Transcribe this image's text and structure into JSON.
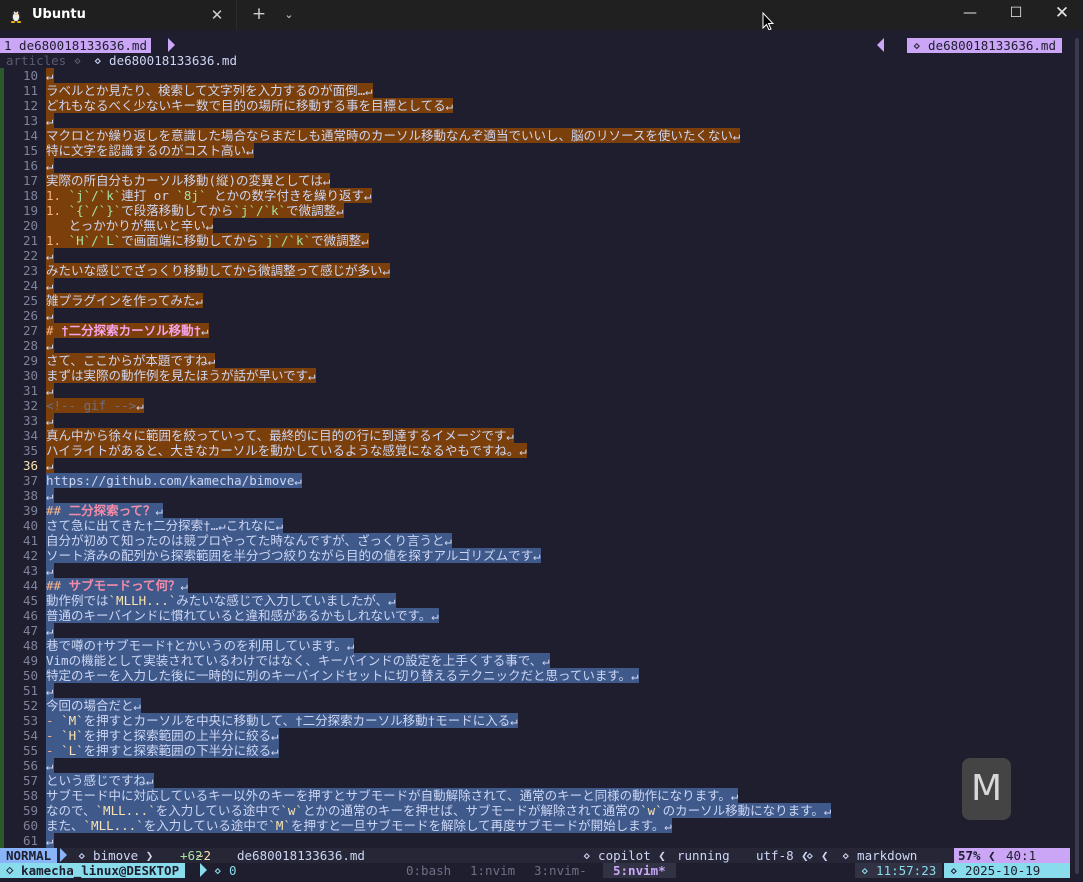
{
  "window": {
    "tab_title": "Ubuntu",
    "tab_close": "✕",
    "new_tab": "+",
    "dropdown": "⌄",
    "minimize": "—",
    "maximize": "☐",
    "close": "✕"
  },
  "tabline": {
    "buffer": "1 de680018133636.md",
    "right": "⋄ de680018133636.md"
  },
  "winbar": {
    "dir": "articles ⋄",
    "file": "⋄ de680018133636.md"
  },
  "editor": {
    "lines": [
      {
        "n": "10",
        "segs": [
          {
            "t": "↵",
            "c": "sel-brown"
          }
        ]
      },
      {
        "n": "11",
        "segs": [
          {
            "t": "ラベルとか見たり、検索して文字列を入力するのが面倒…↵",
            "c": "sel-brown"
          }
        ]
      },
      {
        "n": "12",
        "segs": [
          {
            "t": "どれもなるべく少ないキー数で目的の場所に移動する事を目標としてる↵",
            "c": "sel-brown"
          }
        ]
      },
      {
        "n": "13",
        "segs": [
          {
            "t": "↵",
            "c": "sel-brown"
          }
        ]
      },
      {
        "n": "14",
        "segs": [
          {
            "t": "マクロとか繰り返しを意識した場合ならまだしも通常時のカーソル移動なんぞ適当でいいし、脳のリソースを使いたくない↵",
            "c": "sel-brown"
          }
        ]
      },
      {
        "n": "15",
        "segs": [
          {
            "t": "特に文字を認識するのがコスト高い↵",
            "c": "sel-brown"
          }
        ]
      },
      {
        "n": "16",
        "segs": [
          {
            "t": "↵",
            "c": "sel-brown"
          }
        ]
      },
      {
        "n": "17",
        "segs": [
          {
            "t": "実際の所自分もカーソル移動(縦)の変異としては↵",
            "c": "sel-brown"
          }
        ]
      },
      {
        "n": "18",
        "segs": [
          {
            "t": "1. ",
            "c": "sel-brown c-orange"
          },
          {
            "t": "`j`/`k`",
            "c": "sel-brown c-green"
          },
          {
            "t": "連打 or ",
            "c": "sel-brown"
          },
          {
            "t": "`8j`",
            "c": "sel-brown c-green"
          },
          {
            "t": " とかの数字付きを繰り返す↵",
            "c": "sel-brown"
          }
        ]
      },
      {
        "n": "19",
        "segs": [
          {
            "t": "1. ",
            "c": "sel-brown c-orange"
          },
          {
            "t": "`{`/`}`",
            "c": "sel-brown c-green"
          },
          {
            "t": "で段落移動してから",
            "c": "sel-brown"
          },
          {
            "t": "`j`/`k`",
            "c": "sel-brown c-green"
          },
          {
            "t": "で微調整↵",
            "c": "sel-brown"
          }
        ]
      },
      {
        "n": "20",
        "segs": [
          {
            "t": "   とっかかりが無いと辛い↵",
            "c": "sel-brown"
          }
        ]
      },
      {
        "n": "21",
        "segs": [
          {
            "t": "1. ",
            "c": "sel-brown c-orange"
          },
          {
            "t": "`H`/`L`",
            "c": "sel-brown c-green"
          },
          {
            "t": "で画面端に移動してから",
            "c": "sel-brown"
          },
          {
            "t": "`j`/`k`",
            "c": "sel-brown c-green"
          },
          {
            "t": "で微調整↵",
            "c": "sel-brown"
          }
        ]
      },
      {
        "n": "22",
        "segs": [
          {
            "t": "↵",
            "c": "sel-brown"
          }
        ]
      },
      {
        "n": "23",
        "segs": [
          {
            "t": "みたいな感じでざっくり移動してから微調整って感じが多い↵",
            "c": "sel-brown"
          }
        ]
      },
      {
        "n": "24",
        "segs": [
          {
            "t": "↵",
            "c": "sel-brown"
          }
        ]
      },
      {
        "n": "25",
        "segs": [
          {
            "t": "雑プラグインを作ってみた↵",
            "c": "sel-brown"
          }
        ]
      },
      {
        "n": "26",
        "segs": [
          {
            "t": "↵",
            "c": "sel-brown"
          }
        ]
      },
      {
        "n": "27",
        "segs": [
          {
            "t": "# ",
            "c": "sel-brown c-orange"
          },
          {
            "t": "†二分探索カーソル移動†",
            "c": "sel-brown h-purple"
          },
          {
            "t": "↵",
            "c": "sel-brown"
          }
        ]
      },
      {
        "n": "28",
        "segs": [
          {
            "t": "↵",
            "c": "sel-brown"
          }
        ]
      },
      {
        "n": "29",
        "segs": [
          {
            "t": "さて、ここからが本題ですね↵",
            "c": "sel-brown"
          }
        ]
      },
      {
        "n": "30",
        "segs": [
          {
            "t": "まずは実際の動作例を見たほうが話が早いです↵",
            "c": "sel-brown"
          }
        ]
      },
      {
        "n": "31",
        "segs": [
          {
            "t": "↵",
            "c": "sel-brown"
          }
        ]
      },
      {
        "n": "32",
        "segs": [
          {
            "t": "<!-- gif -->",
            "c": "sel-brown c-gray"
          },
          {
            "t": "↵",
            "c": "sel-brown"
          }
        ]
      },
      {
        "n": "33",
        "segs": [
          {
            "t": "↵",
            "c": "sel-brown"
          }
        ]
      },
      {
        "n": "34",
        "segs": [
          {
            "t": "真ん中から徐々に範囲を絞っていって、最終的に目的の行に到達するイメージです↵",
            "c": "sel-brown"
          }
        ]
      },
      {
        "n": "35",
        "segs": [
          {
            "t": "ハイライトがあると、大きなカーソルを動かしているような感覚になるやもですね。↵",
            "c": "sel-brown"
          }
        ]
      },
      {
        "n": "36",
        "cur": true,
        "segs": [
          {
            "t": "↵",
            "c": "sel-brown"
          }
        ]
      },
      {
        "n": "37",
        "segs": [
          {
            "t": "https://github.com/kamecha/bimove↵",
            "c": "sel-blue"
          }
        ]
      },
      {
        "n": "38",
        "segs": [
          {
            "t": "↵",
            "c": "sel-blue"
          }
        ]
      },
      {
        "n": "39",
        "segs": [
          {
            "t": "## ",
            "c": "sel-blue c-orange"
          },
          {
            "t": "二分探索って？",
            "c": "sel-blue h-red"
          },
          {
            "t": "↵",
            "c": "sel-blue"
          }
        ]
      },
      {
        "n": "40",
        "segs": [
          {
            "t": "さて急に出てきた†二分探索†…↵これなに↵",
            "c": "sel-blue"
          }
        ]
      },
      {
        "n": "41",
        "segs": [
          {
            "t": "自分が初めて知ったのは競プロやってた時なんですが、ざっくり言うと↵",
            "c": "sel-blue"
          }
        ]
      },
      {
        "n": "42",
        "segs": [
          {
            "t": "ソート済みの配列から探索範囲を半分づつ絞りながら目的の値を探すアルゴリズムです↵",
            "c": "sel-blue"
          }
        ]
      },
      {
        "n": "43",
        "segs": [
          {
            "t": "↵",
            "c": "sel-blue"
          }
        ]
      },
      {
        "n": "44",
        "segs": [
          {
            "t": "## ",
            "c": "sel-blue c-orange"
          },
          {
            "t": "サブモードって何？",
            "c": "sel-blue h-red"
          },
          {
            "t": "↵",
            "c": "sel-blue"
          }
        ]
      },
      {
        "n": "45",
        "segs": [
          {
            "t": "動作例では",
            "c": "sel-blue"
          },
          {
            "t": "`MLLH...`",
            "c": "sel-blue c-yellow"
          },
          {
            "t": "みたいな感じで入力していましたが、↵",
            "c": "sel-blue"
          }
        ]
      },
      {
        "n": "46",
        "segs": [
          {
            "t": "普通のキーバインドに慣れていると違和感があるかもしれないです。↵",
            "c": "sel-blue"
          }
        ]
      },
      {
        "n": "47",
        "segs": [
          {
            "t": "↵",
            "c": "sel-blue"
          }
        ]
      },
      {
        "n": "48",
        "segs": [
          {
            "t": "巷で噂の†サブモード†とかいうのを利用しています。↵",
            "c": "sel-blue"
          }
        ]
      },
      {
        "n": "49",
        "segs": [
          {
            "t": "Vimの機能として実装されているわけではなく、キーバインドの設定を上手くする事で、↵",
            "c": "sel-blue"
          }
        ]
      },
      {
        "n": "50",
        "segs": [
          {
            "t": "特定のキーを入力した後に一時的に別のキーバインドセットに切り替えるテクニックだと思っています。↵",
            "c": "sel-blue"
          }
        ]
      },
      {
        "n": "51",
        "segs": [
          {
            "t": "↵",
            "c": "sel-blue"
          }
        ]
      },
      {
        "n": "52",
        "segs": [
          {
            "t": "今回の場合だと↵",
            "c": "sel-blue"
          }
        ]
      },
      {
        "n": "53",
        "segs": [
          {
            "t": "- ",
            "c": "sel-blue c-orange"
          },
          {
            "t": "`M`",
            "c": "sel-blue c-yellow"
          },
          {
            "t": "を押すとカーソルを中央に移動して、†二分探索カーソル移動†モードに入る↵",
            "c": "sel-blue"
          }
        ]
      },
      {
        "n": "54",
        "segs": [
          {
            "t": "- ",
            "c": "sel-blue c-orange"
          },
          {
            "t": "`H`",
            "c": "sel-blue c-yellow"
          },
          {
            "t": "を押すと探索範囲の上半分に絞る↵",
            "c": "sel-blue"
          }
        ]
      },
      {
        "n": "55",
        "segs": [
          {
            "t": "- ",
            "c": "sel-blue c-orange"
          },
          {
            "t": "`L`",
            "c": "sel-blue c-yellow"
          },
          {
            "t": "を押すと探索範囲の下半分に絞る↵",
            "c": "sel-blue"
          }
        ]
      },
      {
        "n": "56",
        "segs": [
          {
            "t": "↵",
            "c": "sel-blue"
          }
        ]
      },
      {
        "n": "57",
        "segs": [
          {
            "t": "という感じですね↵",
            "c": "sel-blue"
          }
        ]
      },
      {
        "n": "58",
        "segs": [
          {
            "t": "サブモード中に対応しているキー以外のキーを押すとサブモードが自動解除されて、通常のキーと同様の動作になります。↵",
            "c": "sel-blue"
          }
        ]
      },
      {
        "n": "59",
        "segs": [
          {
            "t": "なので、",
            "c": "sel-blue"
          },
          {
            "t": "`MLL...`",
            "c": "sel-blue c-yellow"
          },
          {
            "t": "を入力している途中で",
            "c": "sel-blue"
          },
          {
            "t": "`w`",
            "c": "sel-blue c-yellow"
          },
          {
            "t": "とかの通常のキーを押せば、サブモードが解除されて通常の",
            "c": "sel-blue"
          },
          {
            "t": "`w`",
            "c": "sel-blue c-yellow"
          },
          {
            "t": "のカーソル移動になります。↵",
            "c": "sel-blue"
          }
        ]
      },
      {
        "n": "60",
        "segs": [
          {
            "t": "また、",
            "c": "sel-blue"
          },
          {
            "t": "`MLL...`",
            "c": "sel-blue c-yellow"
          },
          {
            "t": "を入力している途中で",
            "c": "sel-blue"
          },
          {
            "t": "`M`",
            "c": "sel-blue c-yellow"
          },
          {
            "t": "を押すと一旦サブモードを解除して再度サブモードが開始します。↵",
            "c": "sel-blue"
          }
        ]
      },
      {
        "n": "61",
        "segs": [
          {
            "t": "↵",
            "c": "sel-blue"
          }
        ]
      }
    ]
  },
  "statusline": {
    "mode": "NORMAL",
    "branch": "⋄ bimove ❯",
    "diff_added": "+62",
    "diff_modified": "~2",
    "filename": "de680018133636.md",
    "copilot": "⋄ copilot ❮",
    "copilot_state": "running",
    "encoding": "utf-8 ❮",
    "enc_icons": "⋄ ❮",
    "filetype": "⋄ markdown",
    "percent": "57% ❮",
    "position": "40:1"
  },
  "tmux": {
    "session": "⋄ kamecha_linux@DESKTOP",
    "count": "⋄ 0",
    "win0": "0:bash",
    "win1": "1:nvim",
    "win3": "3:nvim-",
    "win5": "5:nvim*",
    "clock": "⋄ 11:57:23",
    "date": "⋄ 2025-10-19"
  },
  "overlay": {
    "key": "M"
  },
  "colors": {
    "bg": "#1e1e2e",
    "selection_brown": "#7a3f0a",
    "selection_blue": "#3f5a8a",
    "accent_purple": "#cba6f7",
    "accent_blue": "#89b4fa",
    "accent_cyan": "#89dceb"
  }
}
